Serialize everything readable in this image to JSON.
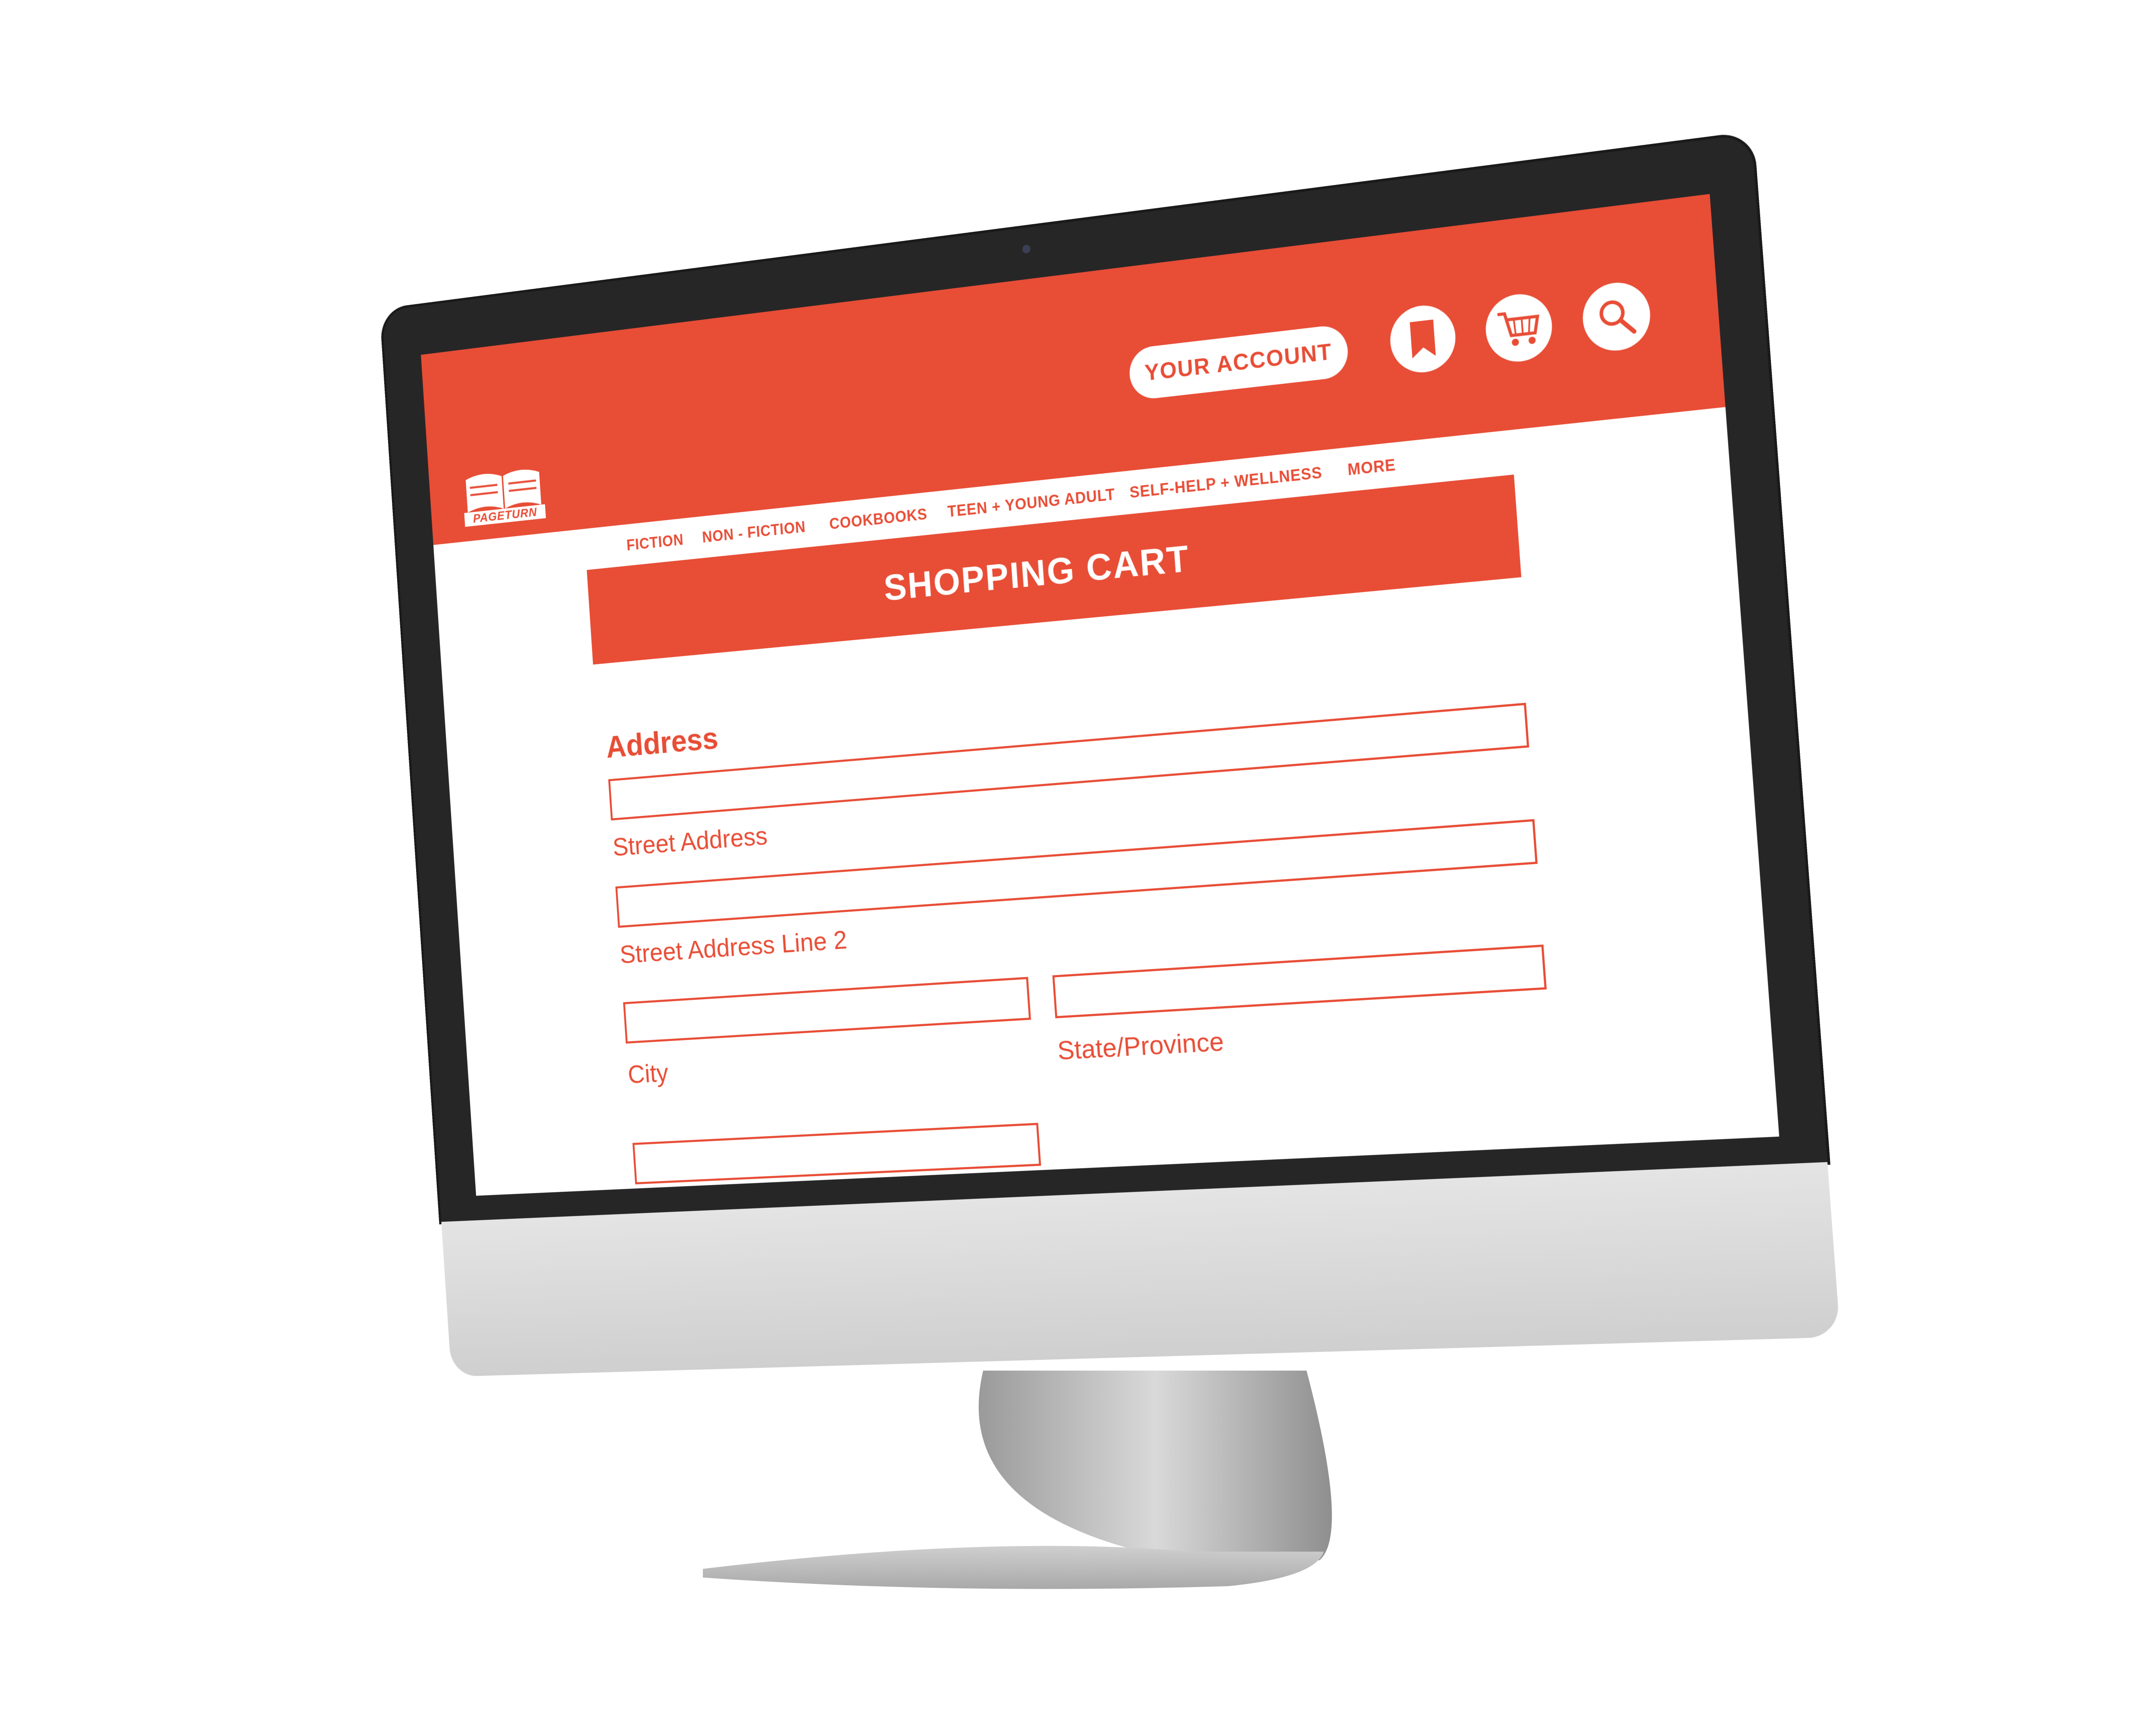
{
  "site": {
    "logo_text": "PAGETURN",
    "account_label": "YOUR ACCOUNT"
  },
  "header_icons": [
    {
      "name": "bookmark-icon"
    },
    {
      "name": "cart-icon"
    },
    {
      "name": "search-icon"
    }
  ],
  "nav": {
    "items": [
      "FICTION",
      "NON - FICTION",
      "COOKBOOKS",
      "TEEN + YOUNG ADULT",
      "SELF-HELP + WELLNESS",
      "MORE"
    ]
  },
  "page": {
    "banner_title": "SHOPPING CART",
    "section_title": "Address"
  },
  "form": {
    "street_label": "Street Address",
    "street2_label": "Street Address Line 2",
    "city_label": "City",
    "state_label": "State/Province"
  },
  "colors": {
    "brand": "#e84d36",
    "bezel": "#262626",
    "chin": "#d8d8d8"
  }
}
